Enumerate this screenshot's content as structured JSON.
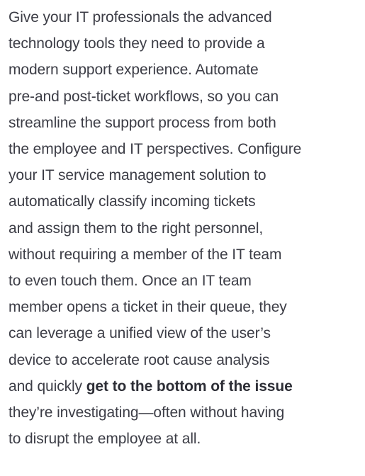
{
  "paragraph": {
    "lines": [
      "Give your IT professionals the advanced",
      "technology tools they need to provide a",
      "modern support experience. Automate",
      "pre-and post-ticket workflows, so you can",
      "streamline the support process from both",
      "the employee and IT perspectives. Configure",
      "your IT service management solution to",
      "automatically classify incoming tickets",
      "and assign them to the right personnel,",
      "without requiring a member of the IT team",
      "to even touch them. Once an IT team",
      "member opens a ticket in their queue, they",
      "can leverage a unified view of the user’s",
      "device to accelerate root cause analysis"
    ],
    "line15_prefix": "and quickly ",
    "line15_bold": "get to the bottom of the issue",
    "line16": "they’re investigating—often without having",
    "line17": "to disrupt the employee at all."
  }
}
